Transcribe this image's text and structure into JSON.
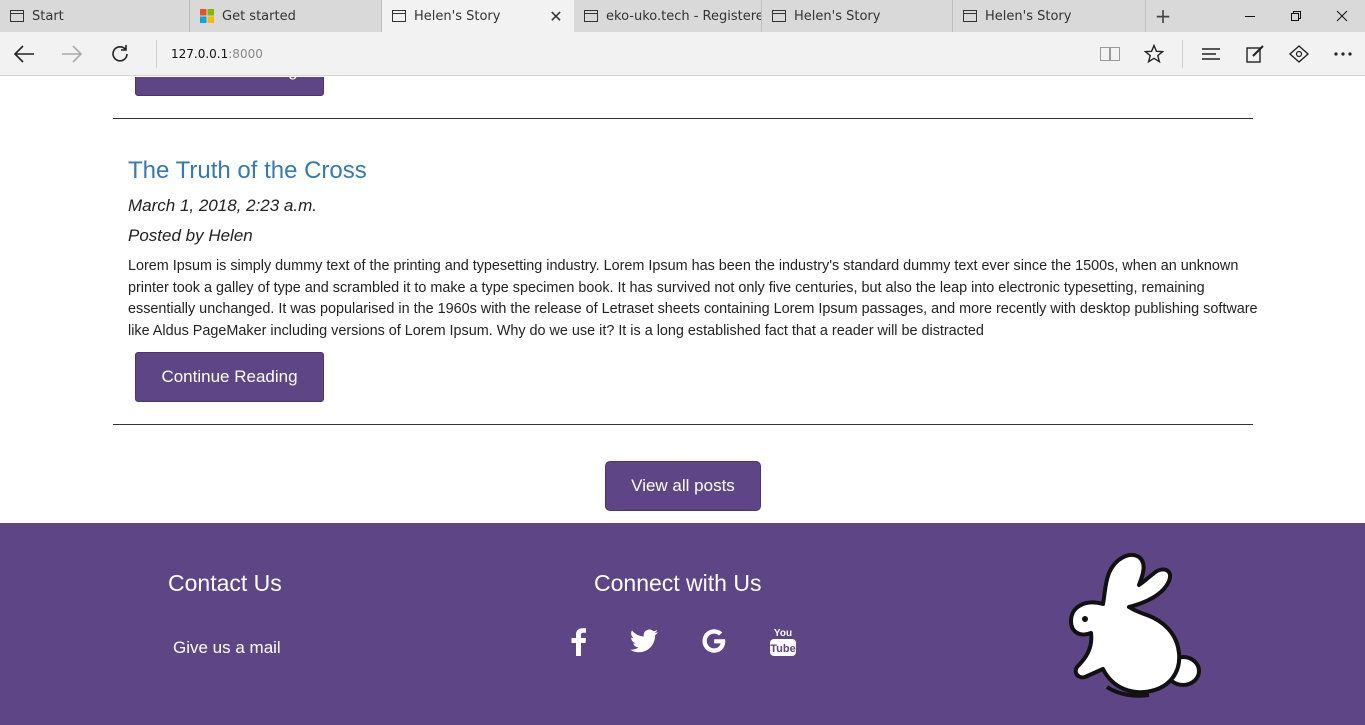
{
  "browser": {
    "tabs": [
      {
        "title": "Start",
        "icon": "page-icon"
      },
      {
        "title": "Get started",
        "icon": "windows-logo-icon"
      },
      {
        "title": "Helen's Story",
        "icon": "page-icon",
        "close": "✕"
      },
      {
        "title": "eko-uko.tech - Registered a",
        "icon": "page-icon"
      },
      {
        "title": "Helen's Story",
        "icon": "page-icon"
      },
      {
        "title": "Helen's Story",
        "icon": "page-icon"
      }
    ],
    "new_tab": "+",
    "address": {
      "host": "127.0.0.1",
      "port": ":8000"
    }
  },
  "page": {
    "previous_button": "Continue Reading",
    "post": {
      "title": "The Truth of the Cross",
      "date": "March 1, 2018, 2:23 a.m.",
      "author": "Posted by Helen",
      "excerpt": "Lorem Ipsum is simply dummy text of the printing and typesetting industry. Lorem Ipsum has been the industry's standard dummy text ever since the 1500s, when an unknown printer took a galley of type and scrambled it to make a type specimen book. It has survived not only five centuries, but also the leap into electronic typesetting, remaining essentially unchanged. It was popularised in the 1960s with the release of Letraset sheets containing Lorem Ipsum passages, and more recently with desktop publishing software like Aldus PageMaker including versions of Lorem Ipsum. Why do we use it? It is a long established fact that a reader will be distracted",
      "continue_button": "Continue Reading"
    },
    "view_all_button": "View all posts"
  },
  "footer": {
    "contact_heading": "Contact Us",
    "contact_link": "Give us a mail",
    "connect_heading": "Connect with Us",
    "social_icons": [
      "facebook-icon",
      "twitter-icon",
      "google-icon",
      "youtube-icon"
    ],
    "logo_icon": "rabbit-logo"
  },
  "colors": {
    "brand_purple": "#5e4585",
    "title_blue": "#337ab7",
    "footer_text": "#ffffff"
  }
}
